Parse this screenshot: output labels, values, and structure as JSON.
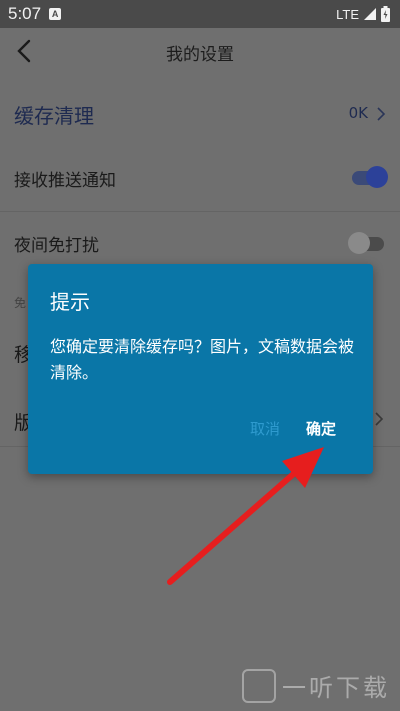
{
  "status_bar": {
    "time": "5:07",
    "notification_badge": "A",
    "network": "LTE"
  },
  "nav": {
    "title": "我的设置"
  },
  "settings": {
    "cache": {
      "label": "缓存清理",
      "value": "0K"
    },
    "push": {
      "label": "接收推送通知",
      "enabled": true
    },
    "night": {
      "label": "夜间免打扰",
      "enabled": false
    },
    "section_partial": "免",
    "row4_partial": "移",
    "row5_partial": "版"
  },
  "dialog": {
    "title": "提示",
    "message": "您确定要清除缓存吗？图片，文稿数据会被清除。",
    "cancel_label": "取消",
    "confirm_label": "确定"
  },
  "watermark": {
    "text": "一听下载"
  },
  "colors": {
    "dialog_bg": "#0a76a7",
    "arrow": "#e61e1e",
    "toggle_on": "#2c4199"
  }
}
